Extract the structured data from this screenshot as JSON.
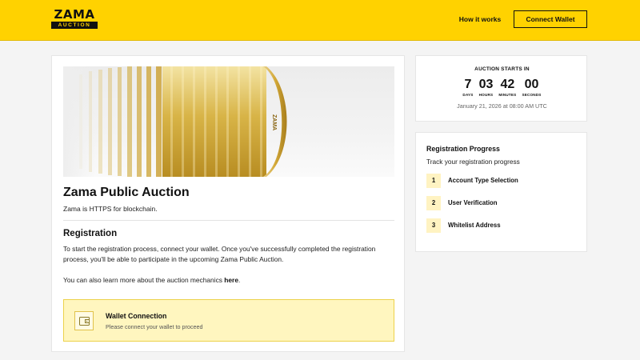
{
  "header": {
    "logo_word": "ZAMA",
    "logo_sub": "AUCTION",
    "nav_link": "How it works",
    "connect_button": "Connect Wallet",
    "accent_color": "#ffd200"
  },
  "main": {
    "title": "Zama Public Auction",
    "subtitle": "Zama is HTTPS for blockchain.",
    "registration_heading": "Registration",
    "registration_text": "To start the registration process, connect your wallet. Once you've successfully completed the registration process, you'll be able to participate in the upcoming Zama Public Auction.",
    "learn_more_prefix": "You can also learn more about the auction mechanics ",
    "learn_more_link": "here",
    "learn_more_suffix": ".",
    "wallet_box": {
      "icon": "wallet-icon",
      "title": "Wallet Connection",
      "subtitle": "Please connect your wallet to proceed"
    },
    "hero_coin_text": "ZAMA"
  },
  "countdown": {
    "label": "AUCTION STARTS IN",
    "days": "7",
    "days_label": "DAYS",
    "hours": "03",
    "hours_label": "HOURS",
    "minutes": "42",
    "minutes_label": "MINUTES",
    "seconds": "00",
    "seconds_label": "SECONDS",
    "date": "January 21, 2026 at 08:00 AM UTC"
  },
  "progress": {
    "title": "Registration Progress",
    "subtitle": "Track your registration progress",
    "steps": [
      {
        "number": "1",
        "label": "Account Type Selection"
      },
      {
        "number": "2",
        "label": "User Verification"
      },
      {
        "number": "3",
        "label": "Whitelist Address"
      }
    ]
  }
}
